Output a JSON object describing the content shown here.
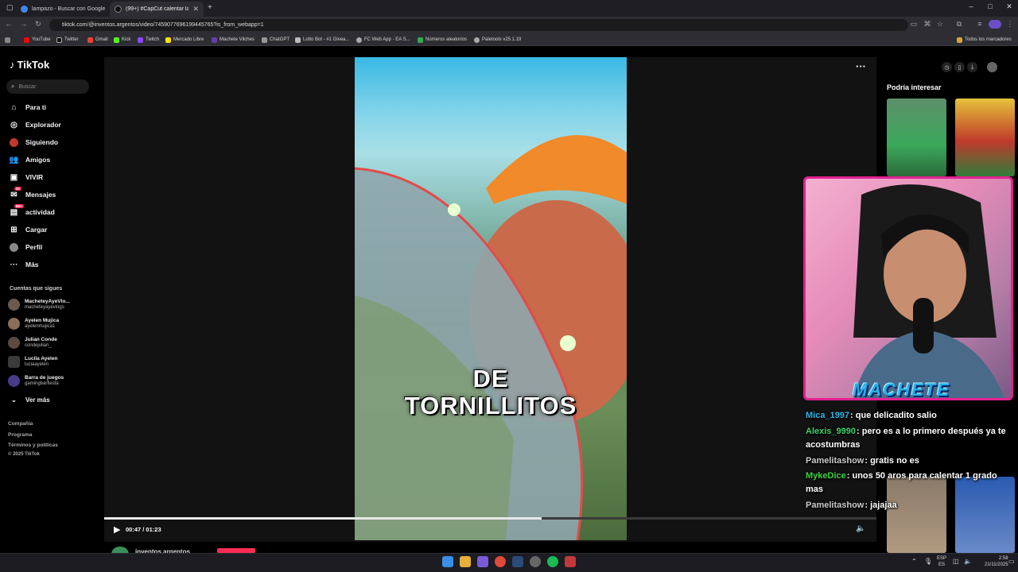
{
  "browser": {
    "tabs": [
      {
        "title": "lampazo - Buscar con Google",
        "active": false
      },
      {
        "title": "(99+) #CapCut calentar la pileta",
        "active": true
      }
    ],
    "url": "tiktok.com/@inventos.argentos/video/7459077696199445765?is_from_webapp=1",
    "bookmarks": [
      "YouTube",
      "Twitter",
      "Gmail",
      "Kick",
      "Twitch",
      "Mercado Libre",
      "Machete Vilches",
      "ChatGPT",
      "Lotto Bot - #1 Givea...",
      "FC Web App - EA S...",
      "Números aleatorios",
      "Paletools v25.1.19"
    ],
    "all_bookmarks": "Todos los marcadores"
  },
  "tiktok": {
    "logo": "TikTok",
    "search_placeholder": "Buscar",
    "nav": [
      {
        "label": "Para ti",
        "icon": "home-icon"
      },
      {
        "label": "Explorador",
        "icon": "compass-icon"
      },
      {
        "label": "Siguiendo",
        "icon": "following-icon"
      },
      {
        "label": "Amigos",
        "icon": "friends-icon"
      },
      {
        "label": "VIVIR",
        "icon": "live-icon"
      },
      {
        "label": "Mensajes",
        "icon": "messages-icon",
        "badge": "21"
      },
      {
        "label": "actividad",
        "icon": "activity-icon",
        "badge": "99+"
      },
      {
        "label": "Cargar",
        "icon": "upload-icon"
      },
      {
        "label": "Perfil",
        "icon": "profile-icon"
      },
      {
        "label": "Más",
        "icon": "more-icon"
      }
    ],
    "following_title": "Cuentas que sigues",
    "following": [
      {
        "name": "MacheteyAyeVlo...",
        "user": "macheteyayevlogs"
      },
      {
        "name": "Ayelen Mujica",
        "user": "ayelenmujica1"
      },
      {
        "name": "Julian Conde",
        "user": "condejulian_"
      },
      {
        "name": "Lucila Ayelen",
        "user": "luciaayelen"
      },
      {
        "name": "Barra de juegos",
        "user": "gamingbarfiesta"
      }
    ],
    "see_more": "Ver más",
    "footer": [
      "Compañía",
      "Programa",
      "Términos y políticas",
      "© 2025 TikTok"
    ],
    "video": {
      "caption": "DE TORNILLITOS",
      "time": "00:47 / 01:23",
      "progress": 0.566,
      "author": "inventos.argentos"
    },
    "recommend_title": "Podría interesar"
  },
  "stream": {
    "streamer": "MACHETE",
    "chat": [
      {
        "user": "Mica_1997",
        "msg": ": que delicadito salio",
        "color": "#2fb7e8"
      },
      {
        "user": "Alexis_9990",
        "msg": ": pero es a lo primero después ya te acostumbras",
        "color": "#39d46a"
      },
      {
        "user": "Pamelitashow",
        "msg": ": gratis no es",
        "color": "#c9c9c9"
      },
      {
        "user": "MykeDice",
        "msg": ": unos 50 aros para calentar 1 grado mas",
        "color": "#3fd43f"
      },
      {
        "user": "Pamelitashow",
        "msg": ": jajajaa",
        "color": "#c9c9c9"
      }
    ]
  },
  "taskbar": {
    "lang": "ESP",
    "lang_sub": "ES",
    "time": "2:58",
    "date": "21/11/2025"
  }
}
